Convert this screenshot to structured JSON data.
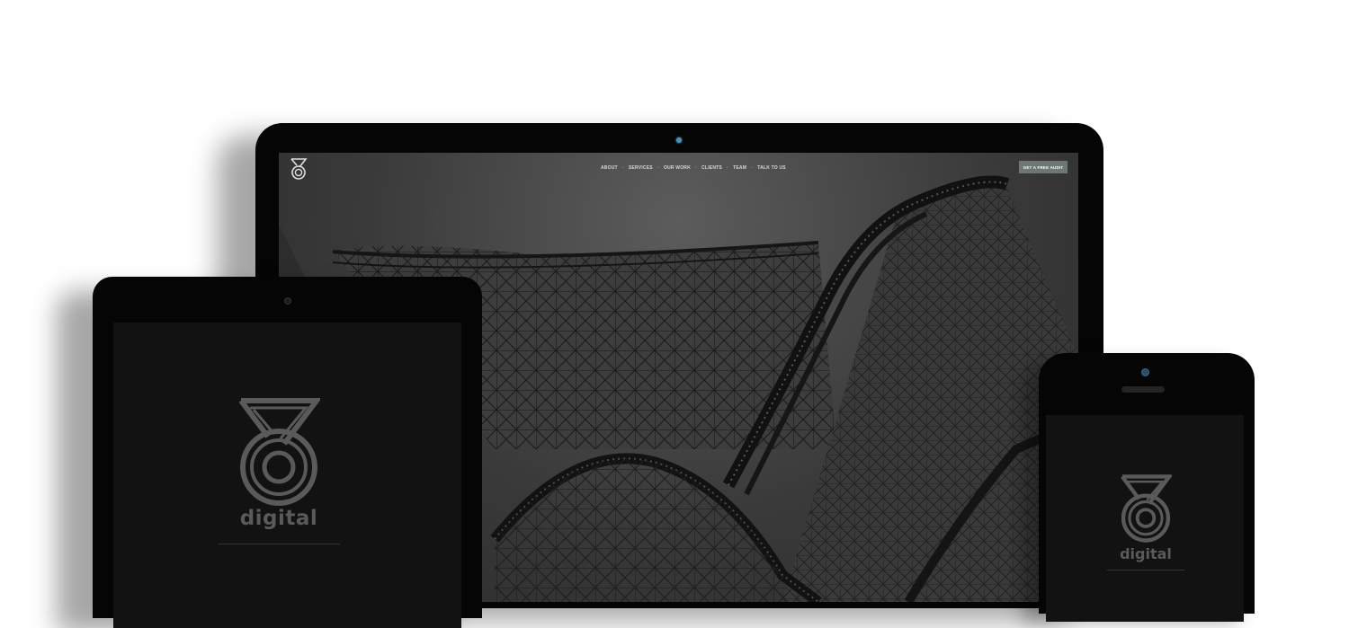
{
  "desktop_site": {
    "nav": [
      "ABOUT",
      "SERVICES",
      "OUR WORK",
      "CLIENTS",
      "TEAM",
      "TALK TO US"
    ],
    "cta_label": "GET A FREE AUDIT",
    "nav_separator": "·"
  },
  "tablet": {
    "wordmark": "digital"
  },
  "phone": {
    "wordmark": "digital"
  },
  "colors": {
    "device_body": "#050505",
    "screen_dark": "#121212",
    "logo_gray": "#5a5a5a",
    "cta_bg": "#6d7776"
  }
}
